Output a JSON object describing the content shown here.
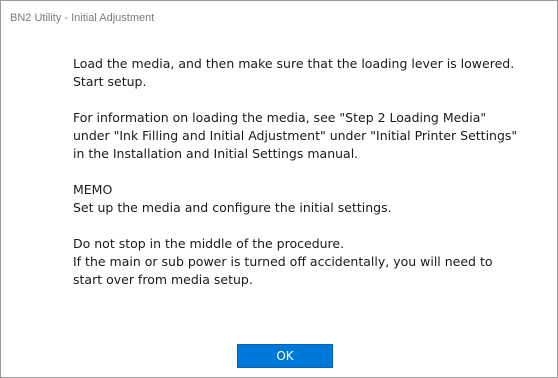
{
  "window": {
    "title": "BN2 Utility - Initial Adjustment"
  },
  "message": {
    "block1": [
      "Load the media, and then make sure that the loading lever is lowered.",
      "Start setup."
    ],
    "block2": [
      "For information on loading the media, see \"Step 2 Loading Media\" under \"Ink Filling and Initial Adjustment\" under \"Initial Printer Settings\" in the Installation and Initial Settings manual."
    ],
    "block3": [
      "MEMO",
      "Set up the media and configure the initial settings."
    ],
    "block4": [
      "Do not stop in the middle of the procedure.",
      "If the main or sub power is turned off accidentally, you will need to start over from media setup."
    ]
  },
  "buttons": {
    "ok_label": "OK"
  },
  "colors": {
    "accent": "#0078d7",
    "title_text": "#7a7a7a",
    "body_text": "#1a1a1a"
  }
}
